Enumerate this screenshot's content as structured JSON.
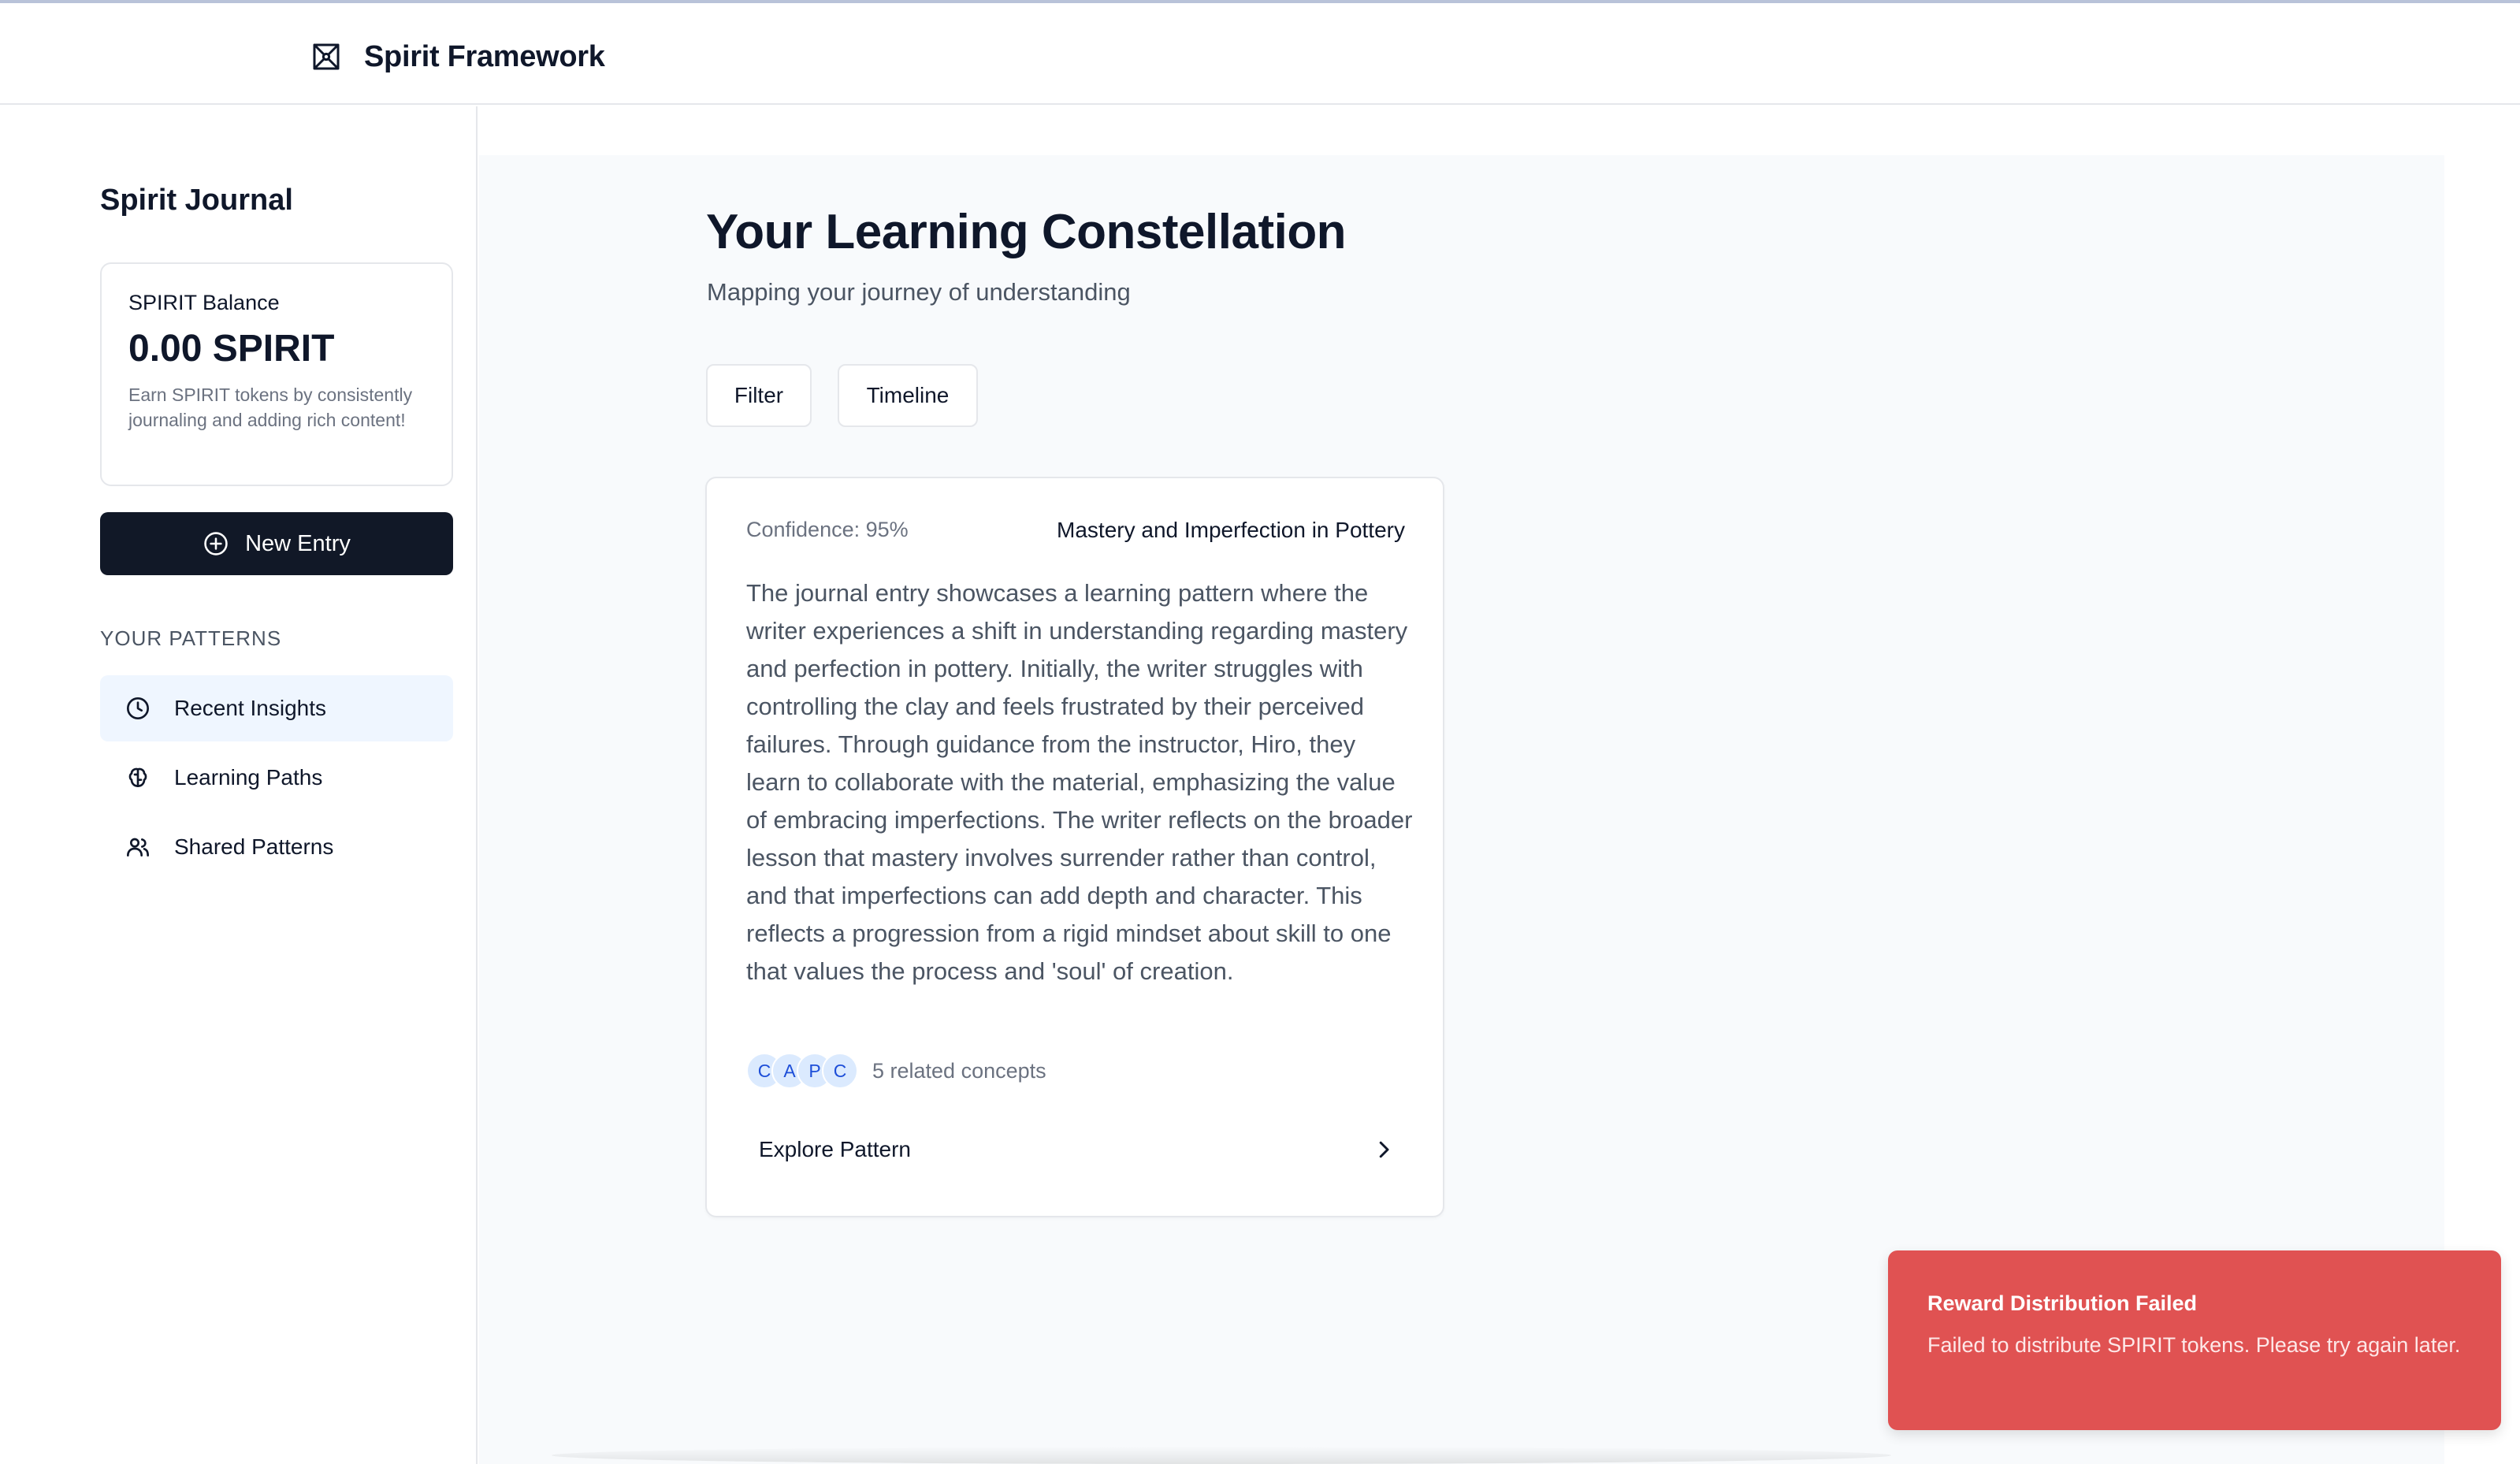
{
  "header": {
    "app_title": "Spirit Framework",
    "logo_icon": "network-icon"
  },
  "sidebar": {
    "title": "Spirit Journal",
    "balance": {
      "label": "SPIRIT Balance",
      "amount": "0.00 SPIRIT",
      "note": "Earn SPIRIT tokens by consistently journaling and adding rich content!"
    },
    "new_entry": {
      "label": "New Entry",
      "icon": "plus-circle-icon"
    },
    "patterns_heading": "YOUR PATTERNS",
    "nav": [
      {
        "label": "Recent Insights",
        "icon": "clock-icon",
        "active": true
      },
      {
        "label": "Learning Paths",
        "icon": "brain-icon",
        "active": false
      },
      {
        "label": "Shared Patterns",
        "icon": "users-icon",
        "active": false
      }
    ]
  },
  "main": {
    "title": "Your Learning Constellation",
    "subtitle": "Mapping your journey of understanding",
    "toolbar": {
      "filter_label": "Filter",
      "timeline_label": "Timeline"
    },
    "pattern_card": {
      "confidence": "Confidence: 95%",
      "title": "Mastery and Imperfection in Pottery",
      "description": "The journal entry showcases a learning pattern where the writer experiences a shift in understanding regarding mastery and perfection in pottery. Initially, the writer struggles with controlling the clay and feels frustrated by their perceived failures. Through guidance from the instructor, Hiro, they learn to collaborate with the material, emphasizing the value of embracing imperfections. The writer reflects on the broader lesson that mastery involves surrender rather than control, and that imperfections can add depth and character. This reflects a progression from a rigid mindset about skill to one that values the process and 'soul' of creation.",
      "concept_initials": [
        "C",
        "A",
        "P",
        "C"
      ],
      "concepts_text": "5 related concepts",
      "explore_label": "Explore Pattern"
    }
  },
  "toast": {
    "title": "Reward Distribution Failed",
    "description": "Failed to distribute SPIRIT tokens. Please try again later.",
    "color": "#e05252"
  },
  "colors": {
    "primary_button": "#111827",
    "active_nav_bg": "#eff6ff",
    "main_bg": "#f8fafc",
    "chip_bg": "#dbeafe",
    "chip_text": "#1d4ed8"
  }
}
